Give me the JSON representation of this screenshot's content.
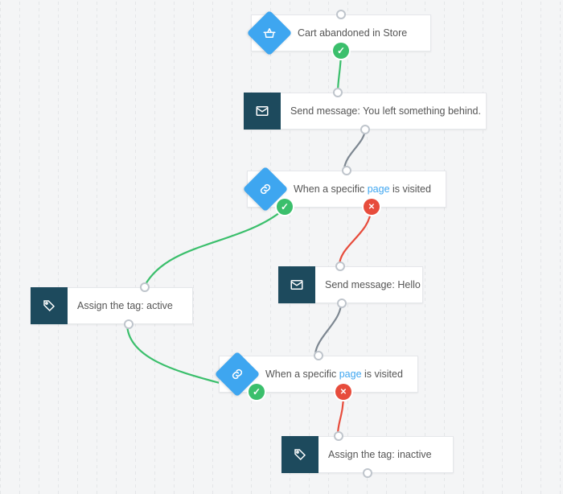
{
  "colors": {
    "diamond": "#3ea6f0",
    "square": "#1d4a5d",
    "yes": "#3bbf6c",
    "no": "#e74c3c",
    "connector_neutral": "#7d8791"
  },
  "nodes": {
    "n1": {
      "type": "trigger",
      "icon": "basket",
      "label": "Cart abandoned in Store"
    },
    "n2": {
      "type": "action",
      "icon": "mail",
      "prefix": "Send message: ",
      "value": "You left something behind."
    },
    "n3": {
      "type": "condition",
      "icon": "link",
      "label_pre": "When a specific ",
      "label_link": "page",
      "label_post": " is visited"
    },
    "n4": {
      "type": "action",
      "icon": "tag",
      "prefix": "Assign the tag: ",
      "value": "active"
    },
    "n5": {
      "type": "action",
      "icon": "mail",
      "prefix": "Send message: ",
      "value": "Hello"
    },
    "n6": {
      "type": "condition",
      "icon": "link",
      "label_pre": "When a specific ",
      "label_link": "page",
      "label_post": " is visited"
    },
    "n7": {
      "type": "action",
      "icon": "tag",
      "prefix": "Assign the tag: ",
      "value": "inactive"
    }
  }
}
